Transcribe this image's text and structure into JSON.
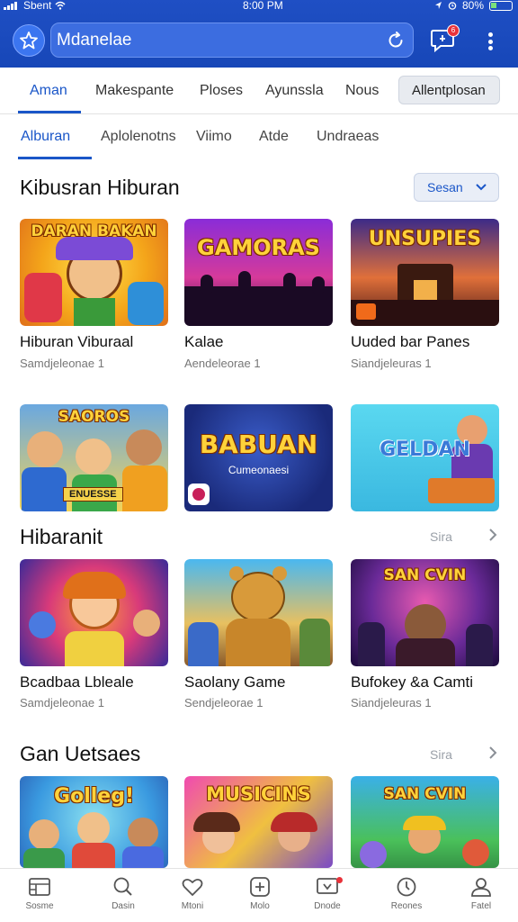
{
  "status": {
    "carrier": "Sbent",
    "time": "8:00 PM",
    "battery": "80%"
  },
  "header": {
    "search_value": "Mdanelae",
    "notification_count": "6"
  },
  "tabs_primary": [
    {
      "label": "Aman",
      "active": true
    },
    {
      "label": "Makespante"
    },
    {
      "label": "Ploses"
    },
    {
      "label": "Ayunssla"
    },
    {
      "label": "Nous"
    },
    {
      "label": "Allentplosan"
    }
  ],
  "tabs_secondary": [
    {
      "label": "Alburan",
      "active": true
    },
    {
      "label": "Aplolenotns"
    },
    {
      "label": "Viimo"
    },
    {
      "label": "Atde"
    },
    {
      "label": "Undraeas"
    }
  ],
  "section1": {
    "title": "Kibusran Hiburan",
    "sort_label": "Sesan",
    "cards": [
      {
        "title": "Hiburan Viburaal",
        "subtitle": "Samdjeleonae 1",
        "art": "DARAN BAKAN"
      },
      {
        "title": "Kalae",
        "subtitle": "Aendeleorae 1",
        "art": "GAMORAS"
      },
      {
        "title": "Uuded bar Panes",
        "subtitle": "Siandjeleuras 1",
        "art": "UNSUPIES"
      }
    ],
    "cards_row2": [
      {
        "art": "SAOROS",
        "art_sub": "ENUESSE"
      },
      {
        "art": "BABUAN",
        "art_sub": "Cumeonaesi"
      },
      {
        "art": "GELDAN"
      }
    ]
  },
  "section2": {
    "title": "Hibaranit",
    "see_all": "Sira",
    "cards": [
      {
        "title": "Bcadbaa Lbleale",
        "subtitle": "Samdjeleonae 1"
      },
      {
        "title": "Saolany Game",
        "subtitle": "Sendjeleorae 1"
      },
      {
        "title": "Bufokey &a Camti",
        "subtitle": "Siandjeleuras 1",
        "art": "SAN CVIN"
      }
    ]
  },
  "section3": {
    "title": "Gan Uetsaes",
    "see_all": "Sira",
    "cards": [
      {
        "art": "Golleg!"
      },
      {
        "art": "MUSICINS"
      },
      {
        "art": "SAN CVIN"
      }
    ]
  },
  "bottom_nav": [
    {
      "label": "Sosme",
      "icon": "calendar-icon"
    },
    {
      "label": "Dasin",
      "icon": "search-icon"
    },
    {
      "label": "Mtoni",
      "icon": "heart-icon"
    },
    {
      "label": "Molo",
      "icon": "plus-square-icon"
    },
    {
      "label": "Dnode",
      "icon": "message-icon"
    },
    {
      "label": "Reones",
      "icon": "compass-icon"
    },
    {
      "label": "Fatel",
      "icon": "user-icon"
    }
  ]
}
